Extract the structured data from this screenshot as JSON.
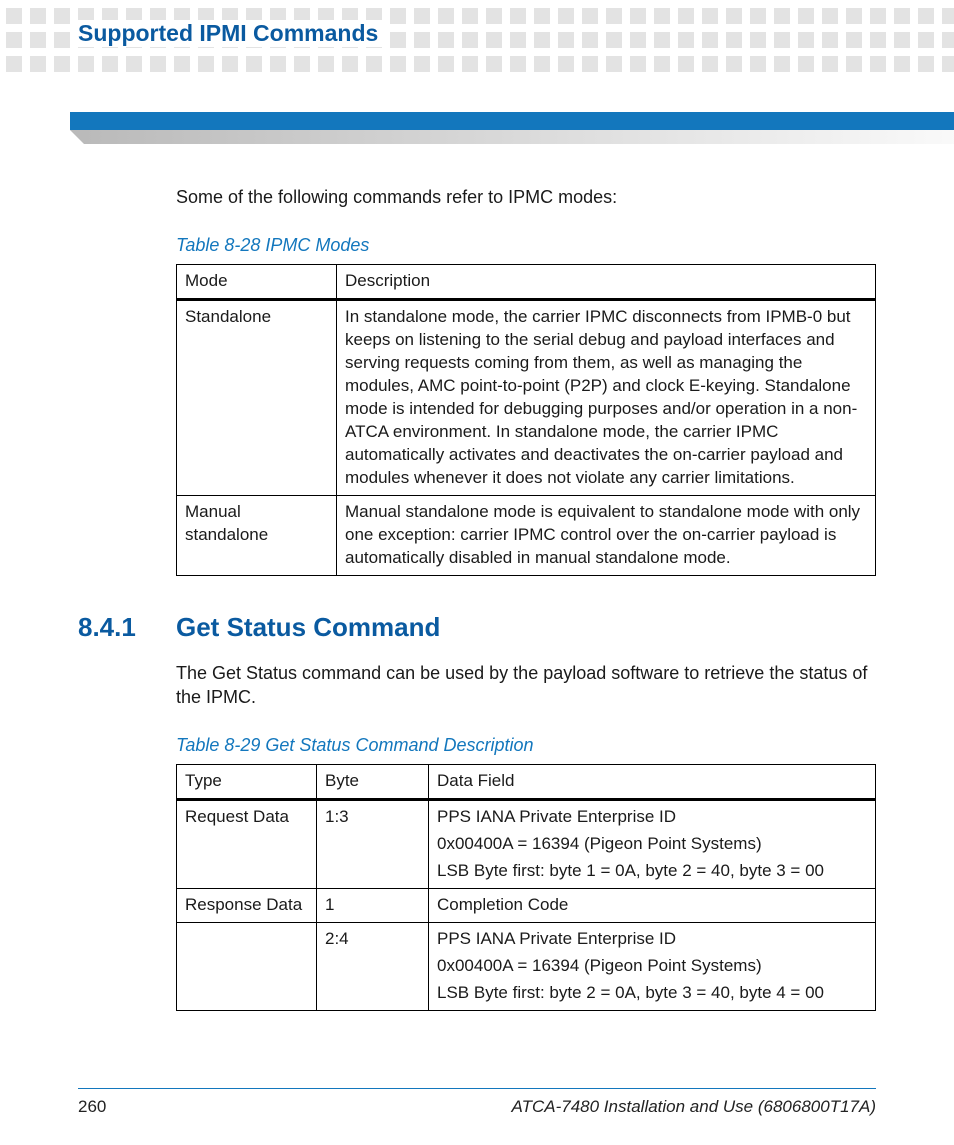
{
  "header": {
    "title": "Supported IPMI Commands"
  },
  "intro": "Some of the following commands refer to IPMC modes:",
  "table1": {
    "caption": "Table 8-28 IPMC Modes",
    "headers": [
      "Mode",
      "Description"
    ],
    "rows": [
      {
        "mode": "Standalone",
        "desc": "In standalone mode, the carrier IPMC disconnects from IPMB-0 but keeps on listening to the serial debug and payload interfaces and serving requests coming from them, as well as managing the modules, AMC point-to-point (P2P) and clock E-keying. Standalone mode is intended for debugging purposes and/or operation in a non-ATCA environment. In standalone mode, the carrier IPMC automatically activates and deactivates the on-carrier payload and modules whenever it does not violate any carrier limitations."
      },
      {
        "mode": "Manual standalone",
        "desc": "Manual standalone mode is equivalent to standalone mode with only one exception: carrier IPMC control over the on-carrier payload is automatically disabled in manual standalone mode."
      }
    ]
  },
  "section": {
    "num": "8.4.1",
    "title": "Get Status Command"
  },
  "section_body": "The Get Status command can be used by the payload software to retrieve the status of the IPMC.",
  "table2": {
    "caption": "Table 8-29 Get Status Command Description",
    "headers": [
      "Type",
      "Byte",
      "Data Field"
    ],
    "rows": [
      {
        "type": "Request Data",
        "byte": "1:3",
        "lines": [
          "PPS IANA Private Enterprise ID",
          "0x00400A = 16394 (Pigeon Point Systems)",
          "LSB Byte first: byte 1 = 0A, byte 2 = 40, byte 3 = 00"
        ]
      },
      {
        "type": "Response Data",
        "byte": "1",
        "lines": [
          "Completion Code"
        ]
      },
      {
        "type": "",
        "byte": "2:4",
        "lines": [
          "PPS IANA Private Enterprise ID",
          "0x00400A = 16394 (Pigeon Point Systems)",
          "LSB Byte first: byte 2 = 0A, byte 3 = 40, byte 4 = 00"
        ]
      }
    ]
  },
  "footer": {
    "page": "260",
    "doc": "ATCA-7480 Installation and Use (6806800T17A)"
  }
}
